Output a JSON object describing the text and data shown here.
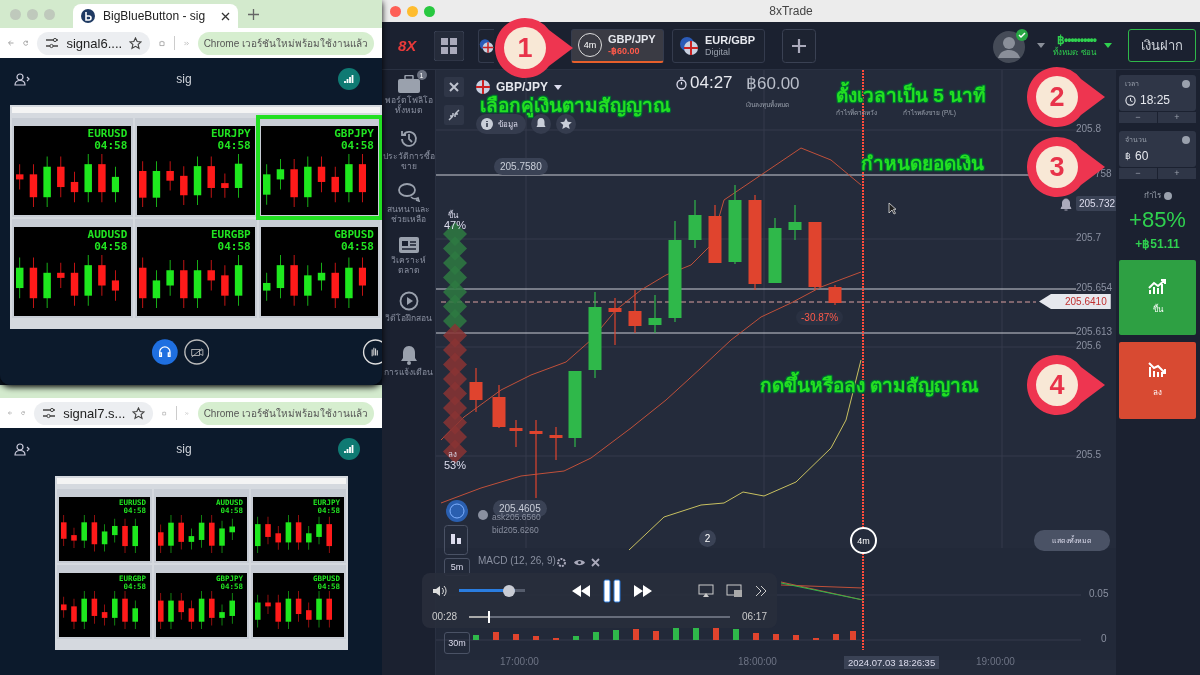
{
  "browser_windows": [
    {
      "tab_title": "BigBlueButton - sig",
      "url": "signal6....",
      "update_notice": "Chrome เวอร์ชันใหม่พร้อมใช้งานแล้ว",
      "room_title": "sig",
      "media_controls": true,
      "shared_screen_panels": [
        {
          "pair": "EURUSD",
          "time": "04:58",
          "highlighted": false
        },
        {
          "pair": "EURJPY",
          "time": "04:58",
          "highlighted": false
        },
        {
          "pair": "GBPJPY",
          "time": "04:58",
          "highlighted": true
        },
        {
          "pair": "AUDUSD",
          "time": "04:58",
          "highlighted": false
        },
        {
          "pair": "EURGBP",
          "time": "04:58",
          "highlighted": false
        },
        {
          "pair": "GBPUSD",
          "time": "04:58",
          "highlighted": false
        }
      ]
    },
    {
      "url": "signal7.s...",
      "update_notice": "Chrome เวอร์ชันใหม่พร้อมใช้งานแล้ว",
      "room_title": "sig",
      "media_controls": false,
      "shared_screen_panels": [
        {
          "pair": "EURUSD",
          "time": "04:58",
          "highlighted": false
        },
        {
          "pair": "AUDUSD",
          "time": "04:58",
          "highlighted": false
        },
        {
          "pair": "EURJPY",
          "time": "04:58",
          "highlighted": false
        },
        {
          "pair": "EURGBP",
          "time": "04:58",
          "highlighted": false
        },
        {
          "pair": "GBPJPY",
          "time": "04:58",
          "highlighted": false
        },
        {
          "pair": "GBPUSD",
          "time": "04:58",
          "highlighted": false
        }
      ]
    }
  ],
  "trading_app": {
    "title": "8xTrade",
    "logo": "8X",
    "asset_tabs": [
      {
        "selected": false
      },
      {
        "timer": "4m",
        "name": "GBP/JPY",
        "detail": "-฿60.00",
        "selected": true
      },
      {
        "name": "EUR/GBP",
        "detail": "Digital",
        "selected": false
      }
    ],
    "account": {
      "balance": "฿••••••••••",
      "balance_note": "ทั้งหมด: ซ่อน",
      "verified": true
    },
    "deposit": "เงินฝาก",
    "sidebar": [
      {
        "kind": "briefcase",
        "label": "พอร์ตโฟลิโอทั้งหมด",
        "badge": "1"
      },
      {
        "kind": "history",
        "label": "ประวัติการซื้อขาย"
      },
      {
        "kind": "chat",
        "label": "สนทนาและช่วยเหลือ"
      },
      {
        "kind": "news",
        "label": "วิเคราะห์ตลาด"
      },
      {
        "kind": "video",
        "label": "วิดีโอฝึกสอน"
      },
      {
        "kind": "bell",
        "label": "การแจ้งเตือน"
      }
    ],
    "chart_header": {
      "asset": "GBP/JPY",
      "timer": "04:27",
      "investment": "฿60.00",
      "investment_label": "เงินลงทุนทั้งหมด",
      "expected_label": "กำไรที่คาดหวัง",
      "pl_label": "กำไรหลังขาย (P/L)",
      "info": "ข้อมูล"
    },
    "sentiment": {
      "up_label": "ขึ้น",
      "up": "47%",
      "down_label": "ลง",
      "down": "53%"
    },
    "price_axis": [
      "205.8",
      "758",
      "205.7",
      "205.654",
      "205.613",
      "205.6",
      "205.5"
    ],
    "tags": {
      "high": "205.7580",
      "low": "205.4605",
      "alert": "205.732",
      "current": "205.6410",
      "change": "-30.87%"
    },
    "quote": {
      "ask": "ask205.6560",
      "bid": "bid205.6260"
    },
    "event_badge": "2",
    "expiry_marker": "4m",
    "show_all": "แสดงทั้งหมด",
    "indicator": "MACD (12, 26, 9)",
    "macd_axis": [
      "0.05",
      "0"
    ],
    "time_axis": [
      "17:00:00",
      "18:00:00",
      "19:00:00"
    ],
    "cursor_time": "2024.07.03 18:26:35",
    "timeframes": [
      "5m",
      "30m"
    ],
    "trade_panel": {
      "time_label": "เวลา",
      "time": "18:25",
      "amount_label": "จำนวน",
      "currency": "฿",
      "amount": "60",
      "minus": "−",
      "plus": "+",
      "profit_label": "กำไร",
      "profit_percent": "+85%",
      "profit_amount": "+฿51.11",
      "up": "ขึ้น",
      "down": "ลง"
    }
  },
  "video_player": {
    "elapsed": "00:28",
    "duration": "06:17",
    "playing": true,
    "volume": {
      "level": 0.85
    },
    "progress": {
      "level": 0.08
    }
  },
  "annotations": [
    {
      "number": "1",
      "text": "เลือกคู่เงินตามสัญญาณ"
    },
    {
      "number": "2",
      "text": "ตั้งเวลาเป็น 5 นาที"
    },
    {
      "number": "3",
      "text": "กำหนดยอดเงิน"
    },
    {
      "number": "4",
      "text": "กดขึ้นหรือลง ตามสัญญาณ"
    }
  ]
}
